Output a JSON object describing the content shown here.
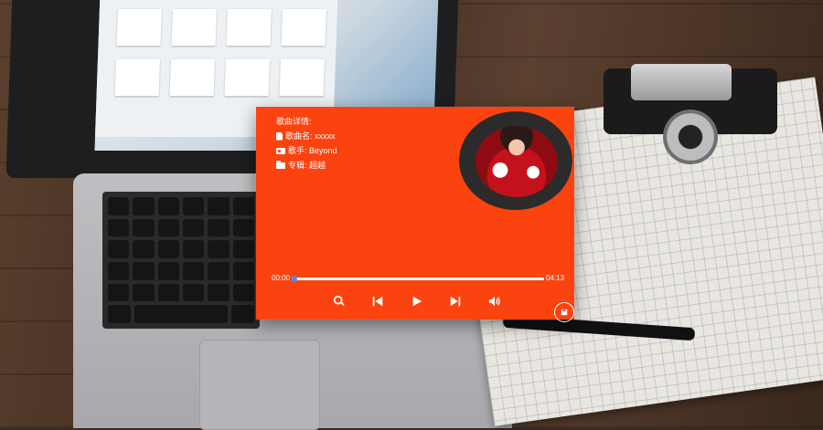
{
  "details": {
    "title": "歌曲详情:",
    "song_name": "歌曲名: xxxxx",
    "singer": "歌手:   Beyond",
    "album": "专辑:  超越"
  },
  "progress": {
    "current_time": "00:00",
    "total_time": "04:13",
    "fraction": 0.0
  },
  "controls": [
    "search-icon",
    "previous-icon",
    "play-icon",
    "next-icon",
    "volume-icon"
  ],
  "colors": {
    "panel": "#fb4310",
    "knob": "#4d8ddb",
    "disc": "#2b2b2b"
  }
}
